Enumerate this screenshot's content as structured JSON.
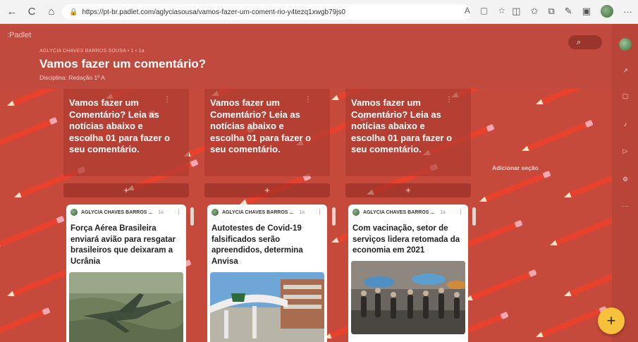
{
  "browser": {
    "url": "https://pt-br.padlet.com/aglyciasousa/vamos-fazer-um-coment-rio-y4tezq1xwgb79js0",
    "back_icon": "←",
    "reload_icon": "C"
  },
  "padlet": {
    "brand": ":Padlet",
    "author_line": "AGLYCIA CHAVES BARROS SOUSA • 1 • 1a",
    "title": "Vamos fazer um comentário?",
    "subtitle": "Disciplina: Redação 1º A",
    "add_section": "Adicionar seção",
    "fab_label": "+"
  },
  "columns": [
    {
      "title": "Vamos fazer um Comentário? Leia as notícias abaixo e escolha 01 para fazer o seu comentário.",
      "add_label": "+",
      "post": {
        "author": "AGLYCIA CHAVES BARROS ...",
        "time": "1a",
        "title": "Força Aérea Brasileira enviará avião para resgatar brasileiros que deixaram a Ucrânia"
      }
    },
    {
      "title": "Vamos fazer um Comentário? Leia as notícias abaixo e escolha 01 para fazer o seu comentário.",
      "add_label": "+",
      "post": {
        "author": "AGLYCIA CHAVES BARROS ...",
        "time": "1a",
        "title": "Autotestes de Covid-19 falsificados serão apreendidos, determina Anvisa"
      }
    },
    {
      "title": "Vamos fazer um Comentário? Leia as notícias abaixo e escolha 01 para fazer o seu comentário.",
      "add_label": "+",
      "post": {
        "author": "AGLYCIA CHAVES BARROS ...",
        "time": "1a",
        "title": "Com vacinação, setor de serviços lidera retomada da economia em 2021"
      }
    }
  ],
  "colors": {
    "background": "#c04a3e",
    "pencil": "#e8422c",
    "eraser": "#f3a7b1",
    "fab": "#f7c23b"
  }
}
